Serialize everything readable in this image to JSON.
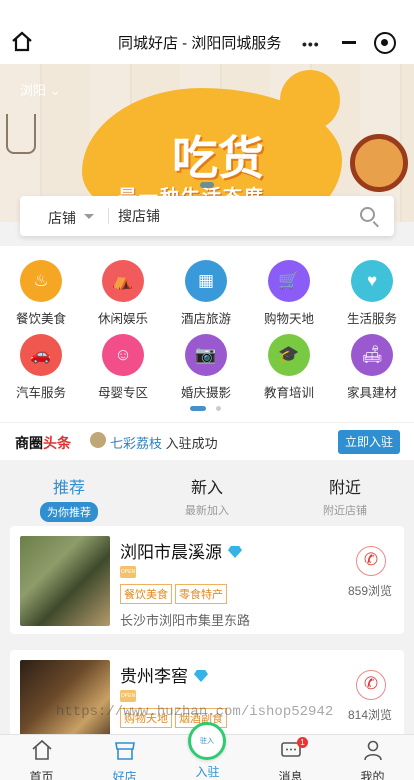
{
  "topbar": {
    "title": "同城好店 - 浏阳同城服务",
    "more": "•••"
  },
  "banner": {
    "city": "浏阳",
    "headline": "吃货",
    "slogan": "是一种生活态度"
  },
  "search": {
    "category": "店铺",
    "placeholder": "搜店铺"
  },
  "categories": [
    {
      "label": "餐饮美食",
      "icon": "chef-hat-icon",
      "color": "#f5a623",
      "glyph": "♨"
    },
    {
      "label": "休闲娱乐",
      "icon": "tent-icon",
      "color": "#f25b5b",
      "glyph": "⛺"
    },
    {
      "label": "酒店旅游",
      "icon": "hotel-icon",
      "color": "#3a9ad9",
      "glyph": "▦"
    },
    {
      "label": "购物天地",
      "icon": "cart-icon",
      "color": "#8b5cf6",
      "glyph": "🛒"
    },
    {
      "label": "生活服务",
      "icon": "hand-heart-icon",
      "color": "#3fc1d9",
      "glyph": "♥"
    },
    {
      "label": "汽车服务",
      "icon": "car-icon",
      "color": "#f0574f",
      "glyph": "🚗"
    },
    {
      "label": "母婴专区",
      "icon": "baby-icon",
      "color": "#f24e8a",
      "glyph": "☺"
    },
    {
      "label": "婚庆摄影",
      "icon": "camera-icon",
      "color": "#9b59d0",
      "glyph": "📷"
    },
    {
      "label": "教育培训",
      "icon": "graduation-cap-icon",
      "color": "#7ac943",
      "glyph": "🎓"
    },
    {
      "label": "家具建材",
      "icon": "sofa-icon",
      "color": "#9b59d0",
      "glyph": "🛋"
    }
  ],
  "headline": {
    "brand_black": "商圈",
    "brand_red": "头条",
    "name": "七彩荔枝",
    "action": "入驻成功",
    "button": "立即入驻"
  },
  "tabs": [
    {
      "title": "推荐",
      "subtitle": "为你推荐"
    },
    {
      "title": "新入",
      "subtitle": "最新加入"
    },
    {
      "title": "附近",
      "subtitle": "附近店铺"
    }
  ],
  "shops": [
    {
      "name": "浏阳市晨溪源",
      "tags": [
        "餐饮美食",
        "零食特产"
      ],
      "address": "长沙市浏阳市集里东路",
      "views": "859浏览",
      "open_label": "OPEN"
    },
    {
      "name": "贵州李窖",
      "tags": [
        "购物天地",
        "烟酒副食"
      ],
      "address": "",
      "views": "814浏览",
      "open_label": "OPEN"
    }
  ],
  "watermark": "https://www.huzhan.com/ishop52942",
  "bottom_nav": [
    {
      "label": "首页"
    },
    {
      "label": "好店"
    },
    {
      "label": "入驻",
      "center": "驻入"
    },
    {
      "label": "消息",
      "badge": "1"
    },
    {
      "label": "我的"
    }
  ],
  "colors": {
    "accent": "#2f8fd0",
    "red": "#e03333",
    "tag": "#e08a20"
  }
}
